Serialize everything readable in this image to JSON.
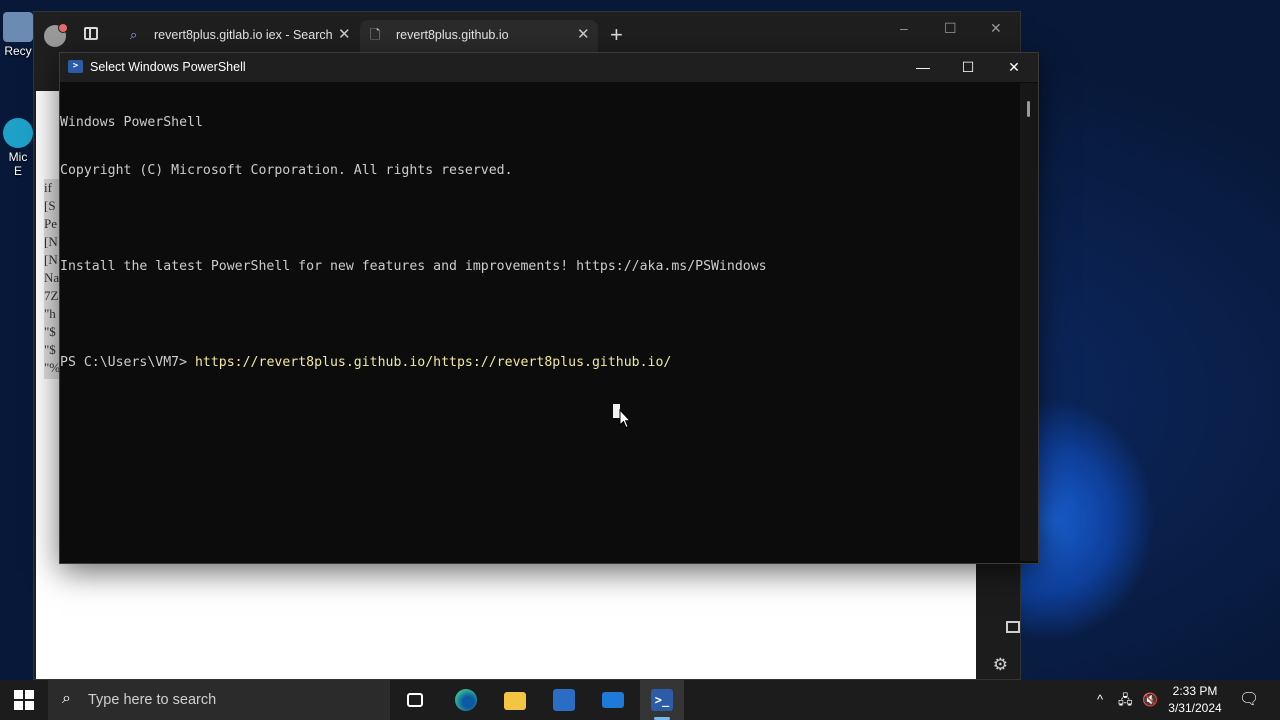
{
  "desktop": {
    "icons": [
      {
        "label": "Recy"
      },
      {
        "label": "Mic\nE"
      }
    ]
  },
  "browser": {
    "tabs": [
      {
        "label": "revert8plus.gitlab.io iex - Search",
        "icon": "search-icon",
        "close": "✕"
      },
      {
        "label": "revert8plus.github.io",
        "icon": "page-icon",
        "close": "✕"
      }
    ],
    "new_tab": "+",
    "controls": {
      "minimize": "–",
      "maximize": "☐",
      "close": "✕"
    },
    "code_fragments": [
      "if",
      "[S",
      "Pe",
      "[N",
      "[N",
      "Na",
      "7Z",
      "\"h",
      "\"$",
      "\"$",
      "\"%"
    ]
  },
  "powershell": {
    "title": "Select Windows PowerShell",
    "controls": {
      "minimize": "—",
      "maximize": "☐",
      "close": "✕"
    },
    "lines": [
      "Windows PowerShell",
      "Copyright (C) Microsoft Corporation. All rights reserved.",
      "",
      "Install the latest PowerShell for new features and improvements! https://aka.ms/PSWindows",
      "",
      "PS C:\\Users\\VM7> "
    ],
    "prompt_command": "https://revert8plus.github.io/https://revert8plus.github.io/"
  },
  "taskbar": {
    "search_placeholder": "Type here to search",
    "apps": [
      "task-view",
      "edge",
      "file-explorer",
      "microsoft-store",
      "mail",
      "powershell"
    ],
    "active_app": "powershell",
    "tray": {
      "chevron": "^",
      "network": "network-icon",
      "volume": "volume-muted-icon",
      "notifications": "notification-icon"
    },
    "time": "2:33 PM",
    "date": "3/31/2024"
  },
  "colors": {
    "console_bg": "#0c0c0c",
    "console_text": "#cccccc",
    "command_text": "#f0e8a0",
    "taskbar_bg": "#1c1c1c",
    "accent": "#76b9ed"
  }
}
